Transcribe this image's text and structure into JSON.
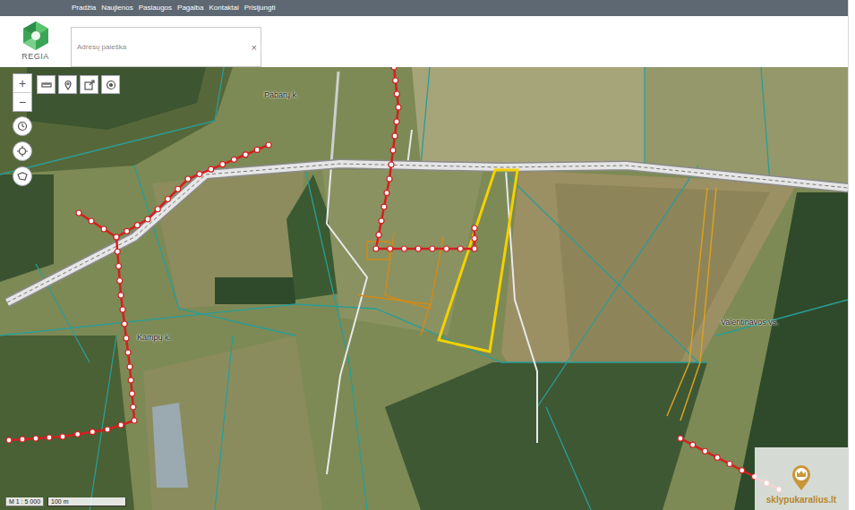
{
  "topbar": {
    "links": [
      "Pradžia",
      "Naujienos",
      "Paslaugos",
      "Pagalba",
      "Kontaktai",
      "Prisijungti"
    ]
  },
  "logo": {
    "text": "REGIA"
  },
  "search": {
    "placeholder": "Adresų paieška",
    "clear": "×"
  },
  "map_controls": {
    "zoom": [
      "+",
      "−"
    ]
  },
  "map": {
    "labels": [
      {
        "text": "Pabarų k."
      },
      {
        "text": "Kampų k."
      },
      {
        "text": "Valentinavos vs."
      }
    ],
    "scale": {
      "ratio": "M 1 : 5 000",
      "distance": "100 m"
    }
  },
  "watermark": {
    "text": "sklypukaralius.lt"
  }
}
